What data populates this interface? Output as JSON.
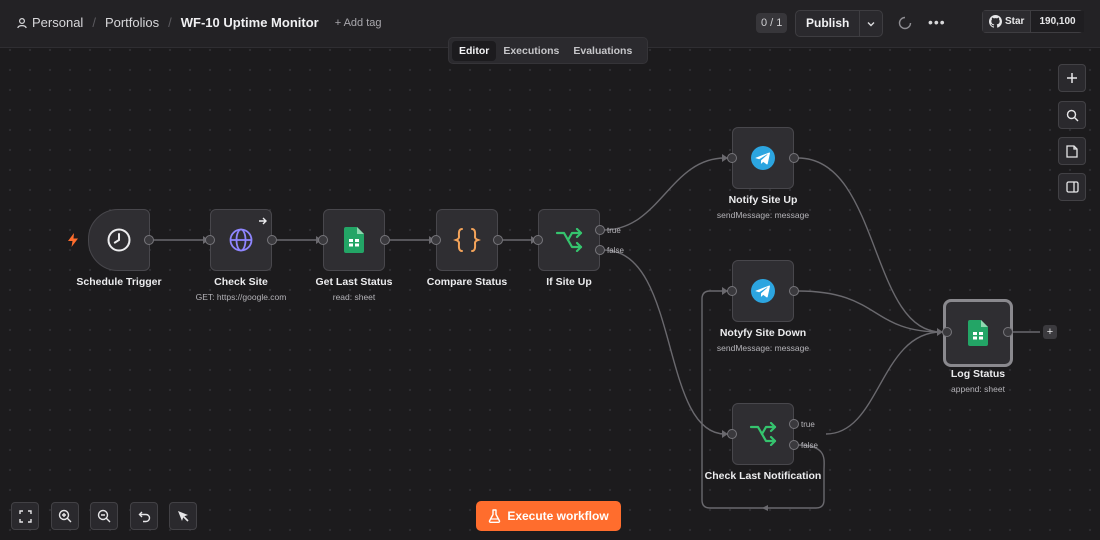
{
  "breadcrumb": {
    "personal": "Personal",
    "portfolios": "Portfolios",
    "workflow_name": "WF-10 Uptime Monitor",
    "add_tag": "+ Add tag"
  },
  "header": {
    "counter": "0 / 1",
    "publish": "Publish",
    "star": "Star",
    "star_count": "190,100"
  },
  "tabs": [
    "Editor",
    "Executions",
    "Evaluations"
  ],
  "nodes": {
    "schedule": {
      "label": "Schedule Trigger",
      "sub": ""
    },
    "check_site": {
      "label": "Check Site",
      "sub": "GET: https://google.com"
    },
    "get_last": {
      "label": "Get Last Status",
      "sub": "read: sheet"
    },
    "compare": {
      "label": "Compare Status",
      "sub": ""
    },
    "if_up": {
      "label": "If Site Up",
      "sub": ""
    },
    "notify_up": {
      "label": "Notify Site Up",
      "sub": "sendMessage: message"
    },
    "notify_down": {
      "label": "Notyfy Site Down",
      "sub": "sendMessage: message"
    },
    "check_last": {
      "label": "Check Last Notification",
      "sub": ""
    },
    "log_status": {
      "label": "Log Status",
      "sub": "append: sheet"
    }
  },
  "branches": {
    "true": "true",
    "false": "false"
  },
  "execute": "Execute workflow",
  "colors": {
    "accent": "#ff6d2d",
    "sheets_green": "#23a566",
    "telegram_blue": "#2ca5e0",
    "if_green": "#35c46e",
    "http_purple": "#8f86ff",
    "code_orange": "#f3a35a"
  },
  "icons": [
    "user-icon",
    "clock-icon",
    "globe-icon",
    "sheets-icon",
    "braces-icon",
    "branch-icon",
    "telegram-icon",
    "plus-icon",
    "search-icon",
    "sticky-note-icon",
    "panel-icon",
    "fit-view-icon",
    "zoom-in-icon",
    "zoom-out-icon",
    "undo-icon",
    "pointer-icon",
    "flask-icon",
    "github-icon",
    "bolt-icon"
  ]
}
